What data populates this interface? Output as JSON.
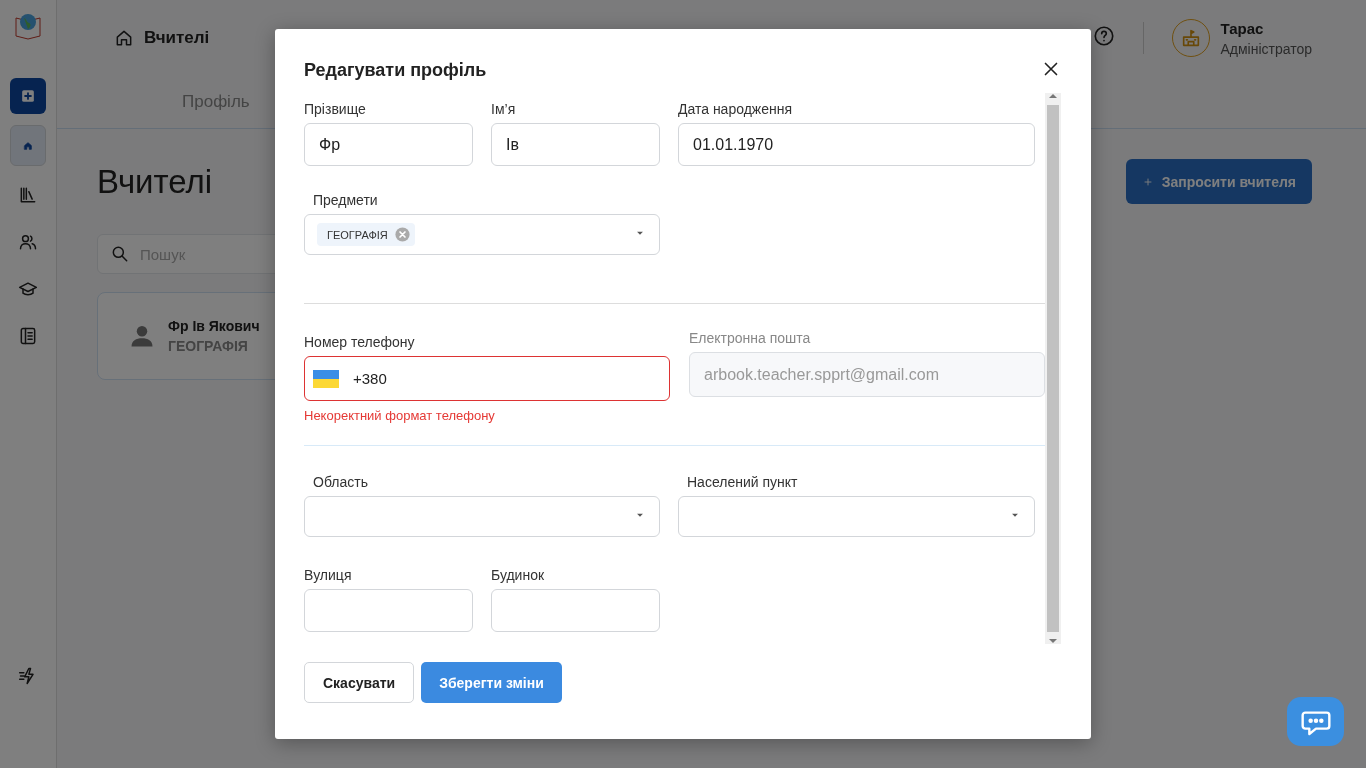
{
  "sidebar": {
    "items": [
      {
        "kind": "add",
        "selected": false
      },
      {
        "kind": "home",
        "selected": true
      },
      {
        "kind": "library",
        "selected": false
      },
      {
        "kind": "people",
        "selected": false
      },
      {
        "kind": "graduation",
        "selected": false
      },
      {
        "kind": "journal",
        "selected": false
      }
    ]
  },
  "header": {
    "breadcrumb": "Вчителі",
    "user": {
      "name": "Тарас",
      "role": "Адміністратор"
    }
  },
  "tabs": [
    {
      "label": "Профіль",
      "selected": false
    }
  ],
  "page": {
    "title": "Вчителі",
    "search": {
      "placeholder": "Пошук"
    },
    "invite_button": "Запросити вчителя",
    "teacher_card": {
      "name": "Фр Ів Якович",
      "subject": "ГЕОГРАФІЯ"
    }
  },
  "modal": {
    "title": "Редагувати профіль",
    "surname": {
      "label": "Прізвище",
      "value": "Фр"
    },
    "first_name": {
      "label": "Ім’я",
      "value": "Ів"
    },
    "birth_date": {
      "label": "Дата народження",
      "value": "01.01.1970"
    },
    "subjects": {
      "label": "Предмети",
      "tags": [
        "ГЕОГРАФІЯ"
      ]
    },
    "phone": {
      "label": "Номер телефону",
      "value": "+380",
      "invalid": true,
      "error": "Некоректний формат телефону"
    },
    "email": {
      "label": "Електронна пошта",
      "value": "arbook.teacher.spprt@gmail.com",
      "disabled": true
    },
    "region": {
      "label": "Область"
    },
    "city": {
      "label": "Населений пункт"
    },
    "street": {
      "label": "Вулиця"
    },
    "house": {
      "label": "Будинок"
    },
    "buttons": {
      "cancel": "Скасувати",
      "save": "Зберегти зміни"
    }
  }
}
